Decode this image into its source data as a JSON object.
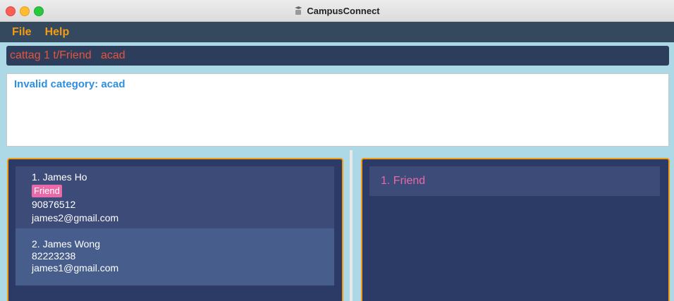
{
  "window": {
    "title": "CampusConnect",
    "app_icon": "campusconnect-app-icon"
  },
  "menu": {
    "items": [
      {
        "label": "File"
      },
      {
        "label": "Help"
      }
    ],
    "color": "#f39c12"
  },
  "command_box": {
    "value": "cattag 1 t/Friend   acad",
    "text_color": "#e8543a"
  },
  "result": {
    "message": "Invalid category: acad",
    "color": "#2e8fe0"
  },
  "persons": [
    {
      "index_name": "1. James Ho",
      "tags": [
        "Friend"
      ],
      "phone": "90876512",
      "email": "james2@gmail.com"
    },
    {
      "index_name": "2. James Wong",
      "tags": [],
      "phone": "82223238",
      "email": "james1@gmail.com"
    }
  ],
  "categories": [
    {
      "label": "1. Friend"
    }
  ],
  "colors": {
    "background": "#add8e6",
    "panel": "#2c3b66",
    "panel_border": "#f39c12",
    "tag": "#e86aa8"
  }
}
